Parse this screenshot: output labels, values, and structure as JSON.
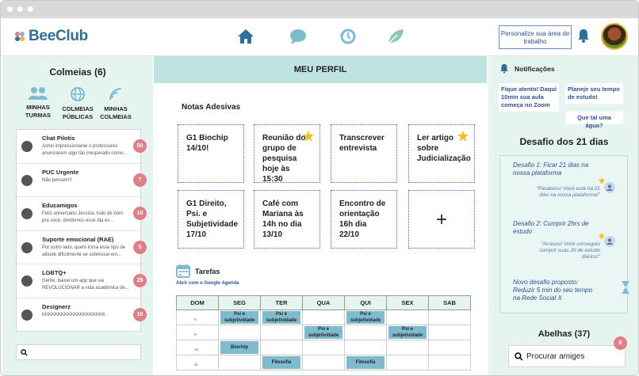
{
  "app": {
    "name": "BeeClub"
  },
  "colors": {
    "accent": "#2f6f98",
    "panel": "#e6f4f0",
    "badge": "#e07f88",
    "event": "#7fbbcf"
  },
  "header": {
    "nav": [
      "home-icon",
      "chat-icon",
      "history-icon",
      "leaf-icon"
    ],
    "personalize": "Personalize sua área de trabalho"
  },
  "left": {
    "title": "Colmeias (6)",
    "tabs": [
      "MINHAS TURMAS",
      "COLMEIAS PÚBLICAS",
      "MINHAS COLMEIAS"
    ],
    "chats": [
      {
        "name": "Chat Pilotis",
        "msg": "Achei impressionante o professores anunciarem algo tão inesperado como...",
        "count": "50"
      },
      {
        "name": "PUC Urgente",
        "msg": "Não percam!!!",
        "count": "7"
      },
      {
        "name": "Educamigos",
        "msg": "Feliz aniversário Jessica, tudo de bom pra você, dividirmos esse dia es...",
        "count": "10"
      },
      {
        "name": "Suporte emocional (RAE)",
        "msg": "Por outro lado, quem toma esse tipo de atitude dificilmente se sobressai em...",
        "count": "5"
      },
      {
        "name": "LGBTQ+",
        "msg": "Gente, baixei um app que vai REVOLUCIONAR a vida acadêmica de...",
        "count": "29"
      },
      {
        "name": "Designerz",
        "msg": "KKKKKKKKKKKKKKKKKKKK",
        "count": "10"
      }
    ]
  },
  "center": {
    "title": "MEU PERFIL",
    "notes_title": "Notas Adesivas",
    "notes": [
      {
        "text": "G1 Biochip 14/10!",
        "star": false
      },
      {
        "text": "Reunião do grupo de pesquisa hoje às 15:30",
        "star": true
      },
      {
        "text": "Transcrever entrevista",
        "star": false
      },
      {
        "text": "Ler artigo sobre Judicialização",
        "star": true
      },
      {
        "text": "G1 Direito, Psi. e Subjetividade 17/10",
        "star": false
      },
      {
        "text": "Café com Mariana às 14h no dia 13/10",
        "star": false
      },
      {
        "text": "Encontro de orientação 16h dia 22/10",
        "star": false
      }
    ],
    "add_label": "+",
    "tasks_title": "Tarefas",
    "gcal_link": "Abrir com o Google Agenda",
    "days": [
      "DOM",
      "SEG",
      "TER",
      "QUA",
      "QUI",
      "SEX",
      "SAB"
    ],
    "hours": [
      "8",
      "9",
      "10",
      "11"
    ],
    "events": {
      "psi": "Psi e subjetividade",
      "biochip": "Biochip",
      "filosofia": "Filosofia"
    }
  },
  "right": {
    "notif_title": "Notificações",
    "notifs": [
      "Fique atento! Daqui 10min sua aula começa no Zoom",
      "Planeje seu tempo de estudo!",
      "Que tal uma água?"
    ],
    "challenge_title": "Desafio dos 21 dias",
    "c1": "Desafio 1: Ficar 21 dias na nossa plataforma",
    "c1_quote": "\"Parabéns! Você está há 21 dias na nossa plataforma!\"",
    "c2": "Desafio 2: Cumprir 2hrs de estudo",
    "c2_quote": "\"Arrasou! Você conseguiu cumprir suas 2h de estudo diários!\"",
    "c3": "Novo desafio proposto: Reduzir 5 min do seu tempo na Rede Social X",
    "bees_title": "Abelhas (37)",
    "search_placeholder": "Procurar amiges",
    "search_badge": "8"
  }
}
